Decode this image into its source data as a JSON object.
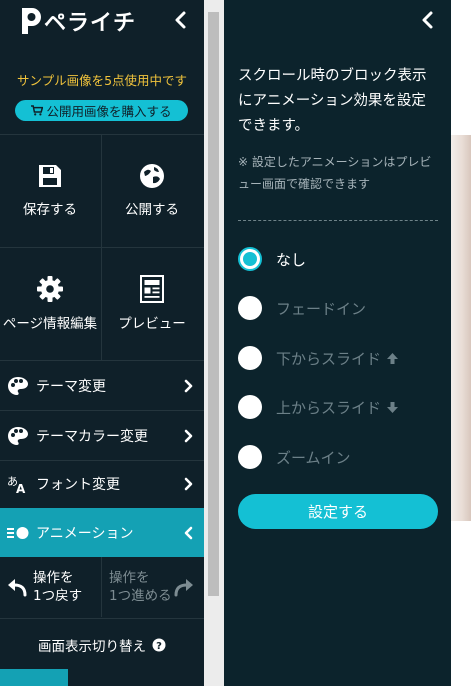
{
  "app": {
    "logo_text": "ペライチ",
    "logo_icon": "perachi-logo-icon"
  },
  "notice": {
    "sample_usage": "サンプル画像を5点使用中です",
    "buy_button": "公開用画像を購入する",
    "buy_icon": "cart-icon"
  },
  "actions": {
    "save": "保存する",
    "publish": "公開する",
    "page_info": "ページ情報編集",
    "preview": "プレビュー"
  },
  "menu": {
    "items": [
      {
        "label": "テーマ変更",
        "icon": "palette-icon"
      },
      {
        "label": "テーマカラー変更",
        "icon": "color-palette-icon"
      },
      {
        "label": "フォント変更",
        "icon": "font-icon"
      },
      {
        "label": "アニメーション",
        "icon": "animation-icon",
        "active": true
      }
    ]
  },
  "history": {
    "undo_line1": "操作を",
    "undo_line2": "1つ戻す",
    "redo_line1": "操作を",
    "redo_line2": "1つ進める"
  },
  "display_toggle": "画面表示切り替え",
  "panel": {
    "description": "スクロール時のブロック表示にアニメーション効果を設定できます。",
    "note": "※ 設定したアニメーションはプレビュー画面で確認できます",
    "options": [
      {
        "label": "なし",
        "selected": true,
        "arrow": ""
      },
      {
        "label": "フェードイン",
        "selected": false,
        "arrow": ""
      },
      {
        "label": "下からスライド",
        "selected": false,
        "arrow": "arrow-up-icon"
      },
      {
        "label": "上からスライド",
        "selected": false,
        "arrow": "arrow-down-icon"
      },
      {
        "label": "ズームイン",
        "selected": false,
        "arrow": ""
      }
    ],
    "apply_button": "設定する"
  },
  "colors": {
    "sidebar_bg": "#0f2029",
    "panel_bg": "#0c232c",
    "accent": "#14c0d4",
    "active_menu": "#14a1b4",
    "notice_text": "#f0c33c",
    "disabled_text": "#6c8088"
  }
}
